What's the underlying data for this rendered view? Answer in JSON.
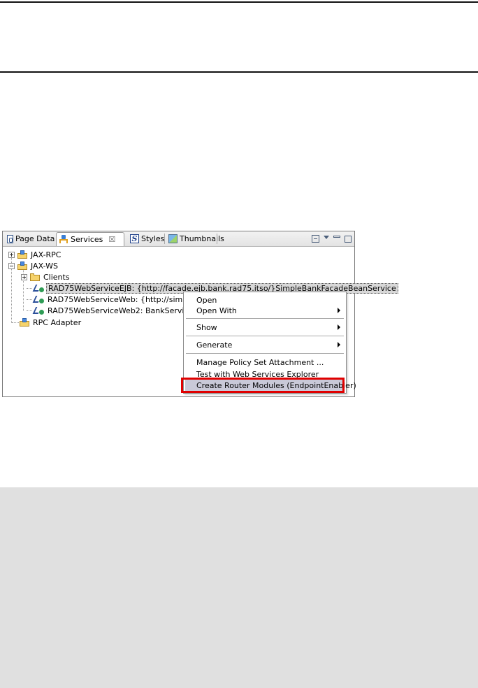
{
  "tabs": [
    {
      "label": "Page Data",
      "icon": "page-data-icon"
    },
    {
      "label": "Services",
      "icon": "services-icon",
      "active": true
    },
    {
      "label": "Styles",
      "icon": "styles-icon"
    },
    {
      "label": "Thumbnails",
      "icon": "thumbnails-icon"
    }
  ],
  "close_glyph": "☒",
  "styles_glyph": "S",
  "tree": {
    "items": [
      "JAX-RPC",
      "JAX-WS",
      "Clients",
      "RAD75WebServiceEJB: {http://facade.ejb.bank.rad75.itso/}SimpleBankFacadeBeanService",
      "RAD75WebServiceWeb: {http://simple.mod",
      "RAD75WebServiceWeb2: BankService",
      "RPC Adapter"
    ]
  },
  "context_menu": {
    "items": [
      "Open",
      "Open With",
      "Show",
      "Generate",
      "Manage Policy Set Attachment ...",
      "Test with Web Services Explorer",
      "Create Router Modules (EndpointEnabler)"
    ],
    "highlight_color": "#e00000"
  }
}
